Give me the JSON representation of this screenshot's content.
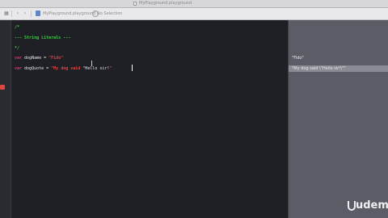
{
  "window": {
    "title": "MyPlayground.playground"
  },
  "jumpbar": {
    "path": "MyPlayground.playground",
    "crumb": "No Selection",
    "nav_back_glyph": "‹",
    "nav_forward_glyph": "›",
    "grid_glyph": "▦"
  },
  "editor": {
    "lines": [
      {
        "parts": [
          {
            "t": "/*",
            "c": "comment"
          }
        ]
      },
      {
        "parts": [
          {
            "t": "--- String Literals ---",
            "c": "comment"
          }
        ]
      },
      {
        "parts": [
          {
            "t": "*/",
            "c": "comment"
          }
        ]
      },
      {
        "parts": [
          {
            "t": "var",
            "c": "kw"
          },
          {
            "t": " dogName = ",
            "c": "plain"
          },
          {
            "t": "\"Fido\"",
            "c": "str"
          }
        ]
      },
      {
        "parts": [
          {
            "t": "var",
            "c": "kw"
          },
          {
            "t": " dogQuote = ",
            "c": "plain"
          },
          {
            "t": "\"My dog said ",
            "c": "str"
          },
          {
            "t": "\"Hello sir!",
            "c": "plain"
          },
          {
            "t": "\"",
            "c": "str"
          }
        ]
      }
    ]
  },
  "results": {
    "items": [
      "\"Fido\"",
      "\"My dog said \\\"Hello sir!\\\"\""
    ]
  },
  "watermark": {
    "brand": "udemy"
  },
  "colors": {
    "comment": "#41cc45",
    "keyword": "#d8327a",
    "string": "#e0413d",
    "editor_bg": "#1f2026",
    "sidebar_bg": "#5b5c66"
  }
}
